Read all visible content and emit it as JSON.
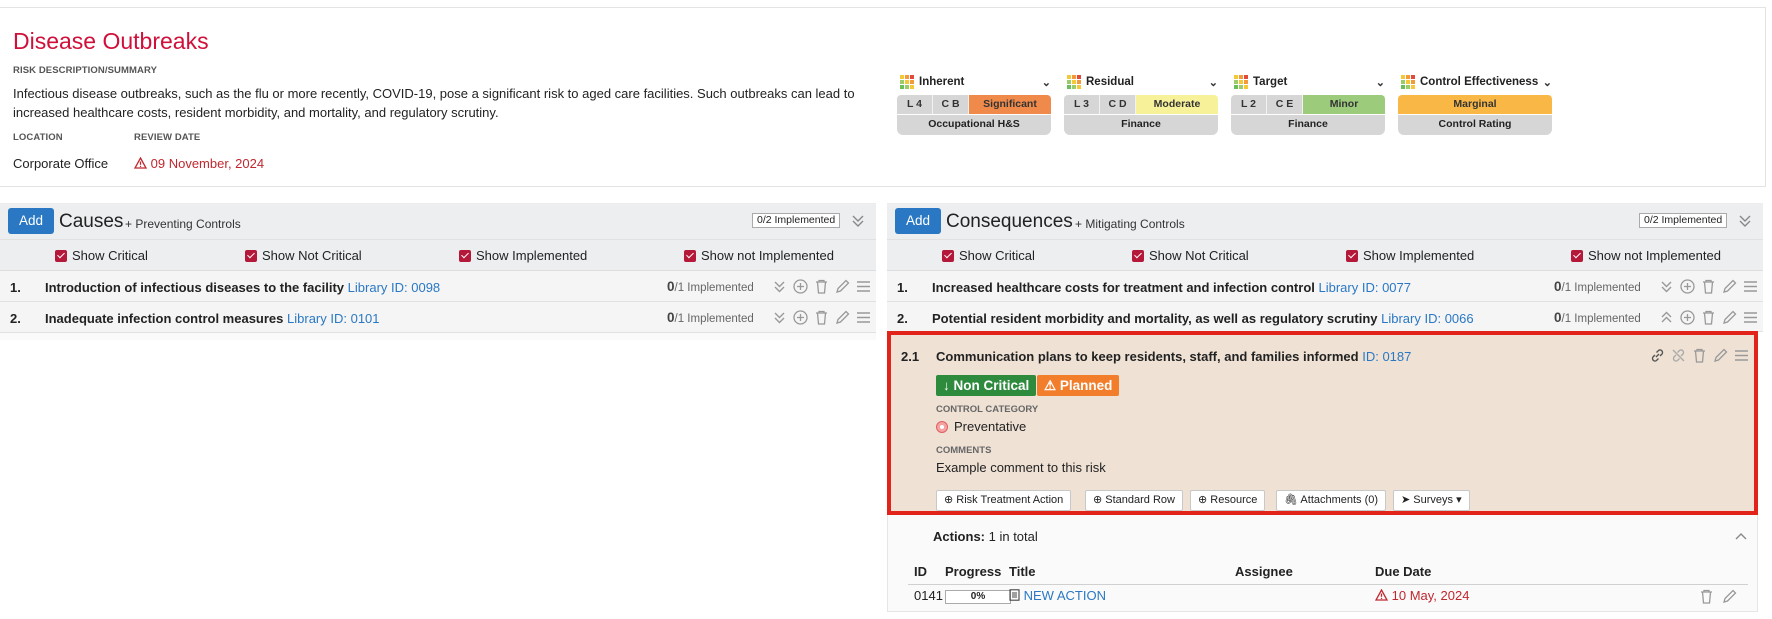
{
  "header": {
    "title": "Disease Outbreaks",
    "risk_description_label": "RISK DESCRIPTION/SUMMARY",
    "risk_description": "Infectious disease outbreaks, such as the flu or more recently, COVID-19, pose a significant risk to aged care facilities. Such outbreaks can lead to increased healthcare costs, resident morbidity, and mortality, and regulatory scrutiny.",
    "location_label": "LOCATION",
    "location": "Corporate Office",
    "review_date_label": "REVIEW DATE",
    "review_date": "09 November, 2024"
  },
  "ratings": [
    {
      "title": "Inherent",
      "l": "L 4",
      "c": "C B",
      "value": "Significant",
      "value_color": "#f08a4b",
      "footer": "Occupational H&S"
    },
    {
      "title": "Residual",
      "l": "L 3",
      "c": "C D",
      "value": "Moderate",
      "value_color": "#f7f29a",
      "footer": "Finance"
    },
    {
      "title": "Target",
      "l": "L 2",
      "c": "C E",
      "value": "Minor",
      "value_color": "#9bcb7b",
      "footer": "Finance"
    },
    {
      "title": "Control Effectiveness",
      "value": "Marginal",
      "value_color": "#f9b845",
      "footer": "Control Rating"
    }
  ],
  "causes": {
    "add_label": "Add",
    "title": "Causes",
    "subtitle": "+ Preventing Controls",
    "implemented_badge": "0/2 Implemented",
    "filters": [
      "Show Critical",
      "Show Not Critical",
      "Show Implemented",
      "Show not Implemented"
    ],
    "items": [
      {
        "num": "1.",
        "text": "Introduction of infectious diseases to the facility",
        "library_id": "Library ID: 0098",
        "count": "0",
        "count_rest": "/1 Implemented"
      },
      {
        "num": "2.",
        "text": "Inadequate infection control measures",
        "library_id": "Library ID: 0101",
        "count": "0",
        "count_rest": "/1 Implemented"
      }
    ]
  },
  "consequences": {
    "add_label": "Add",
    "title": "Consequences",
    "subtitle": "+ Mitigating Controls",
    "implemented_badge": "0/2 Implemented",
    "filters": [
      "Show Critical",
      "Show Not Critical",
      "Show Implemented",
      "Show not Implemented"
    ],
    "items": [
      {
        "num": "1.",
        "text": "Increased healthcare costs for treatment and infection control",
        "library_id": "Library ID: 0077",
        "count": "0",
        "count_rest": "/1 Implemented"
      },
      {
        "num": "2.",
        "text": "Potential resident morbidity and mortality, as well as regulatory scrutiny",
        "library_id": "Library ID: 0066",
        "count": "0",
        "count_rest": "/1 Implemented"
      }
    ]
  },
  "control": {
    "num": "2.1",
    "title": "Communication plans to keep residents, staff, and families informed",
    "id": "ID: 0187",
    "badge_critical": "Non Critical",
    "badge_status": "Planned",
    "category_label": "CONTROL CATEGORY",
    "category": "Preventative",
    "comments_label": "COMMENTS",
    "comments": "Example comment to this risk",
    "buttons": [
      "Risk Treatment Action",
      "Standard Row",
      "Resource",
      "Attachments (0)",
      "Surveys"
    ]
  },
  "actions": {
    "label": "Actions:",
    "total": "1 in total",
    "columns": [
      "ID",
      "Progress",
      "Title",
      "Assignee",
      "Due Date"
    ],
    "rows": [
      {
        "id": "0141",
        "progress": "0%",
        "title": "NEW ACTION",
        "assignee": "",
        "due_date": "10 May, 2024"
      }
    ]
  }
}
